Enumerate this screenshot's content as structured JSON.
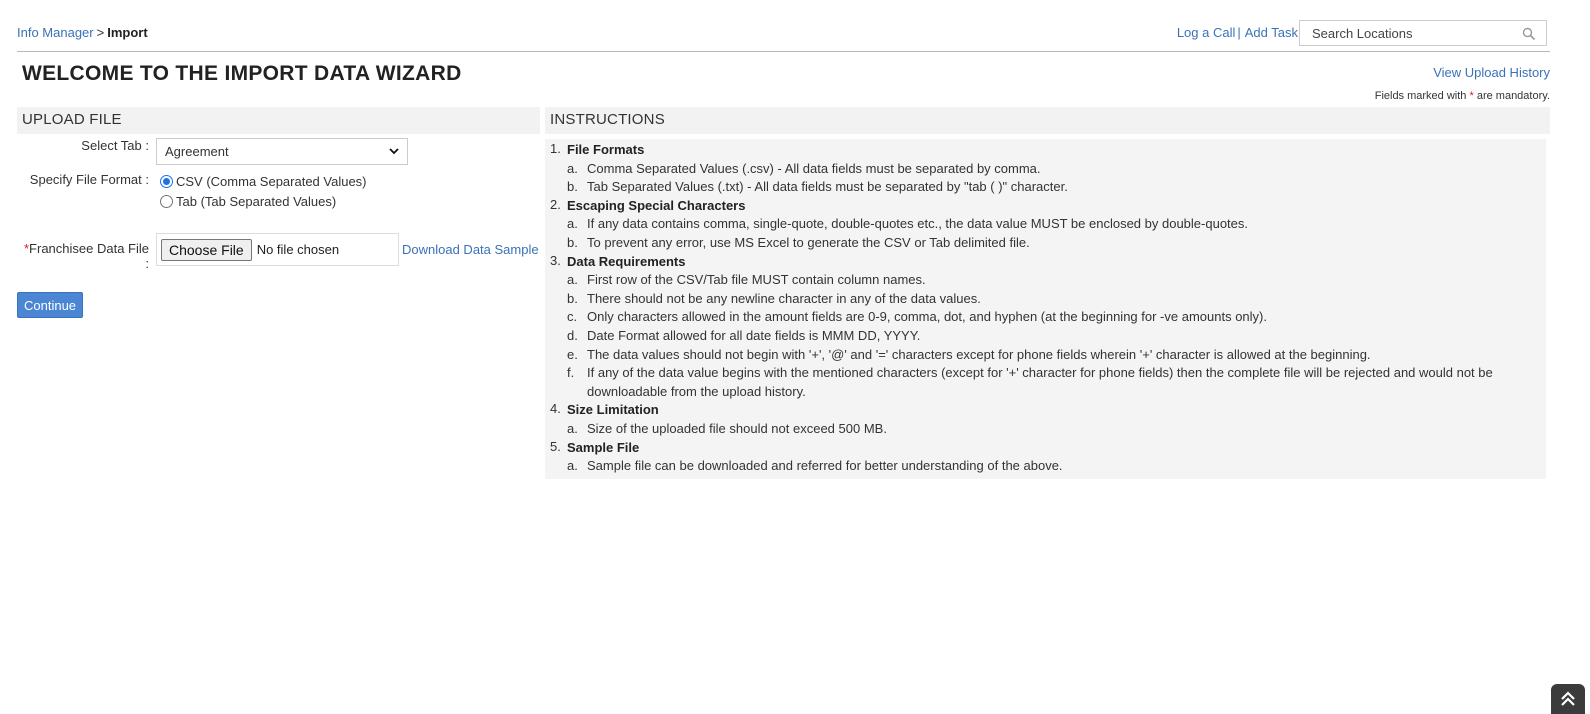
{
  "breadcrumb": {
    "parent": "Info Manager",
    "separator": ">",
    "current": "Import"
  },
  "header_links": {
    "log_call": "Log a Call",
    "pipe": "|",
    "add_task": "Add Task"
  },
  "search": {
    "placeholder": "Search Locations",
    "icon": "search-icon"
  },
  "page": {
    "title": "WELCOME TO THE IMPORT DATA WIZARD",
    "view_history": "View Upload History",
    "mandatory_prefix": "Fields marked with",
    "mandatory_star": "*",
    "mandatory_suffix": "are mandatory."
  },
  "upload": {
    "header": "UPLOAD FILE",
    "select_tab_label": "Select Tab :",
    "select_tab_value": "Agreement",
    "file_format_label": "Specify File Format :",
    "format_csv": "CSV (Comma Separated Values)",
    "format_tab": "Tab (Tab Separated Values)",
    "selected_format": "csv",
    "file_label_star": "*",
    "file_label": "Franchisee Data File :",
    "choose_file": "Choose File",
    "no_file": "No file chosen",
    "download_sample": "Download Data Sample",
    "continue": "Continue"
  },
  "instructions": {
    "header": "INSTRUCTIONS",
    "sections": [
      {
        "num": "1.",
        "title": "File Formats",
        "items": [
          {
            "letter": "a.",
            "text": "Comma Separated Values (.csv) - All data fields must be separated by comma."
          },
          {
            "letter": "b.",
            "text": "Tab Separated Values (.txt) - All data fields must be separated by \"tab ( )\" character."
          }
        ]
      },
      {
        "num": "2.",
        "title": "Escaping Special Characters",
        "items": [
          {
            "letter": "a.",
            "text": "If any data contains comma, single-quote, double-quotes etc., the data value MUST be enclosed by double-quotes."
          },
          {
            "letter": "b.",
            "text": "To prevent any error, use MS Excel to generate the CSV or Tab delimited file."
          }
        ]
      },
      {
        "num": "3.",
        "title": "Data Requirements",
        "items": [
          {
            "letter": "a.",
            "text": "First row of the CSV/Tab file MUST contain column names."
          },
          {
            "letter": "b.",
            "text": "There should not be any newline character in any of the data values."
          },
          {
            "letter": "c.",
            "text": "Only characters allowed in the amount fields are 0-9, comma, dot, and hyphen (at the beginning for -ve amounts only)."
          },
          {
            "letter": "d.",
            "text": "Date Format allowed for all date fields is MMM DD, YYYY."
          },
          {
            "letter": "e.",
            "text": "The data values should not begin with '+', '@' and '=' characters except for phone fields wherein '+' character is allowed at the beginning."
          },
          {
            "letter": "f.",
            "text": "If any of the data value begins with the mentioned characters (except for '+' character for phone fields) then the complete file will be rejected and would not be downloadable from the upload history."
          }
        ]
      },
      {
        "num": "4.",
        "title": "Size Limitation",
        "items": [
          {
            "letter": "a.",
            "text": "Size of the uploaded file should not exceed 500 MB."
          }
        ]
      },
      {
        "num": "5.",
        "title": "Sample File",
        "items": [
          {
            "letter": "a.",
            "text": "Sample file can be downloaded and referred for better understanding of the above."
          }
        ]
      }
    ]
  },
  "scroll_top": {
    "icon": "double-chevron-up-icon"
  }
}
